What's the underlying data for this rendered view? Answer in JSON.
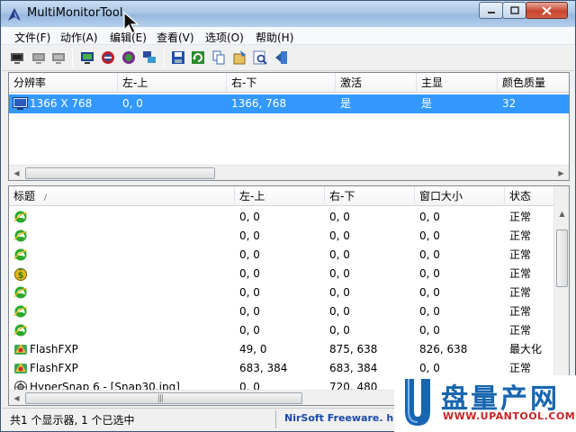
{
  "window": {
    "title": "MultiMonitorTool"
  },
  "menu": [
    {
      "label": "文件(F)"
    },
    {
      "label": "动作(A)"
    },
    {
      "label": "编辑(E)"
    },
    {
      "label": "查看(V)"
    },
    {
      "label": "选项(O)"
    },
    {
      "label": "帮助(H)"
    }
  ],
  "toolbar": {
    "icons": [
      "disable-monitor-icon",
      "enable-monitor-icon",
      "switch-monitor-icon",
      "set-primary-icon",
      "disable-all-icon",
      "enable-all-icon",
      "identify-icon",
      "move-windows-icon",
      "save-icon",
      "refresh-icon",
      "copy-icon",
      "properties-icon",
      "find-icon",
      "exit-icon"
    ]
  },
  "monitors": {
    "columns": [
      "分辨率",
      "左-上",
      "右-下",
      "激活",
      "主显",
      "颜色质量"
    ],
    "rows": [
      {
        "resolution": "1366 X 768",
        "left_top": "0, 0",
        "right_bottom": "1366, 768",
        "active": "是",
        "primary": "是",
        "color": "32"
      }
    ]
  },
  "windows": {
    "columns": [
      "标题",
      "左-上",
      "右-下",
      "窗口大小",
      "状态"
    ],
    "rows": [
      {
        "icon": "ie-icon",
        "title": "",
        "left_top": "0, 0",
        "right_bottom": "0, 0",
        "size": "0, 0",
        "state": "正常"
      },
      {
        "icon": "ie-icon",
        "title": "",
        "left_top": "0, 0",
        "right_bottom": "0, 0",
        "size": "0, 0",
        "state": "正常"
      },
      {
        "icon": "ie-icon",
        "title": "",
        "left_top": "0, 0",
        "right_bottom": "0, 0",
        "size": "0, 0",
        "state": "正常"
      },
      {
        "icon": "money-icon",
        "title": "",
        "left_top": "0, 0",
        "right_bottom": "0, 0",
        "size": "0, 0",
        "state": "正常"
      },
      {
        "icon": "ie-icon",
        "title": "",
        "left_top": "0, 0",
        "right_bottom": "0, 0",
        "size": "0, 0",
        "state": "正常"
      },
      {
        "icon": "ie-icon",
        "title": "",
        "left_top": "0, 0",
        "right_bottom": "0, 0",
        "size": "0, 0",
        "state": "正常"
      },
      {
        "icon": "ie-icon",
        "title": "",
        "left_top": "0, 0",
        "right_bottom": "0, 0",
        "size": "0, 0",
        "state": "正常"
      },
      {
        "icon": "flashfxp-icon",
        "title": "FlashFXP",
        "left_top": "49, 0",
        "right_bottom": "875, 638",
        "size": "826, 638",
        "state": "最大化"
      },
      {
        "icon": "flashfxp-icon",
        "title": "FlashFXP",
        "left_top": "683, 384",
        "right_bottom": "683, 384",
        "size": "0, 0",
        "state": "正常"
      },
      {
        "icon": "hypersnap-icon",
        "title": "HyperSnap 6 - [Snap30.jpg]",
        "left_top": "0, 0",
        "right_bottom": "720, 480",
        "size": "",
        "state": ""
      }
    ]
  },
  "status": {
    "left": "共1 个显示器, 1 个已选中",
    "right": "NirSoft Freeware.  h"
  },
  "watermark": {
    "cn": "盘量产网",
    "url": "WWW.UPANTOOL.COM"
  },
  "colors": {
    "selection": "#3399ff",
    "accent": "#1766b0"
  }
}
